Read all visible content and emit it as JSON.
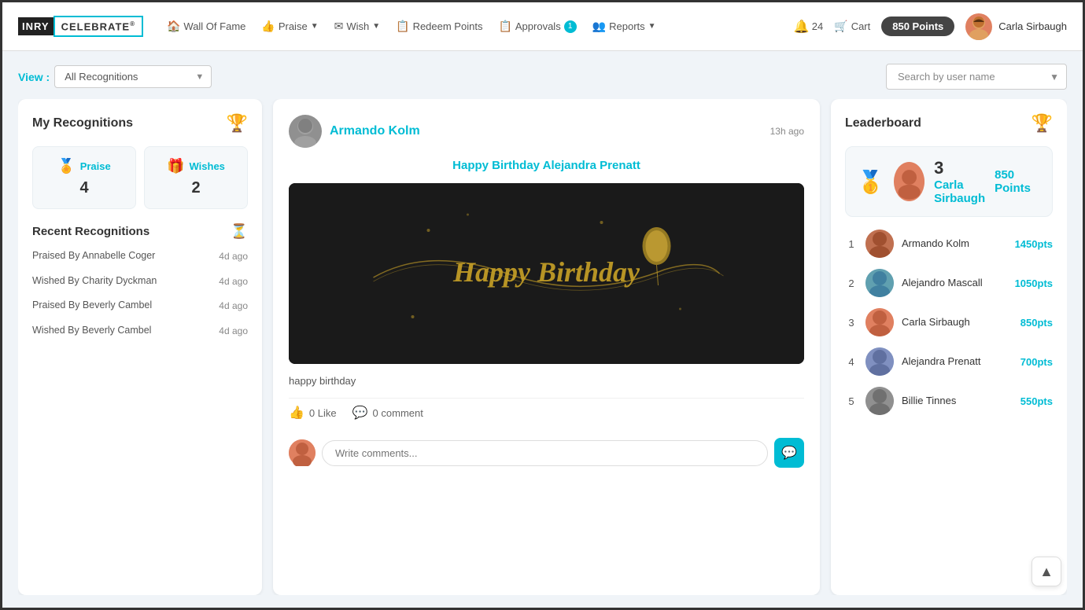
{
  "app": {
    "logo_inry": "INRY",
    "logo_celebrate": "CELEBRATE"
  },
  "navbar": {
    "wall_of_fame": "Wall Of Fame",
    "praise": "Praise",
    "wish": "Wish",
    "redeem_points": "Redeem Points",
    "approvals": "Approvals",
    "approvals_count": "1",
    "reports": "Reports",
    "bell_count": "24",
    "cart": "Cart",
    "points_label": "850 Points",
    "user_name": "Carla Sirbaugh"
  },
  "view_bar": {
    "label": "View :",
    "selected": "All Recognitions",
    "search_placeholder": "Search by user name"
  },
  "my_recognitions": {
    "title": "My Recognitions",
    "praise_label": "Praise",
    "praise_count": "4",
    "wishes_label": "Wishes",
    "wishes_count": "2",
    "recent_title": "Recent Recognitions",
    "items": [
      {
        "text": "Praised By Annabelle Coger",
        "time": "4d ago"
      },
      {
        "text": "Wished By Charity Dyckman",
        "time": "4d ago"
      },
      {
        "text": "Praised By Beverly Cambel",
        "time": "4d ago"
      },
      {
        "text": "Wished By Beverly Cambel",
        "time": "4d ago"
      }
    ]
  },
  "post": {
    "user_name": "Armando Kolm",
    "time": "13h ago",
    "title": "Happy Birthday Alejandra Prenatt",
    "caption": "happy birthday",
    "like_label": "0 Like",
    "comment_label": "0 comment",
    "comment_placeholder": "Write comments..."
  },
  "leaderboard": {
    "title": "Leaderboard",
    "featured": {
      "rank": "3",
      "name": "Carla Sirbaugh",
      "points": "850 Points"
    },
    "items": [
      {
        "rank": "1",
        "name": "Armando Kolm",
        "points": "1450pts"
      },
      {
        "rank": "2",
        "name": "Alejandro Mascall",
        "points": "1050pts"
      },
      {
        "rank": "3",
        "name": "Carla Sirbaugh",
        "points": "850pts"
      },
      {
        "rank": "4",
        "name": "Alejandra Prenatt",
        "points": "700pts"
      },
      {
        "rank": "5",
        "name": "Billie Tinnes",
        "points": "550pts"
      }
    ]
  }
}
